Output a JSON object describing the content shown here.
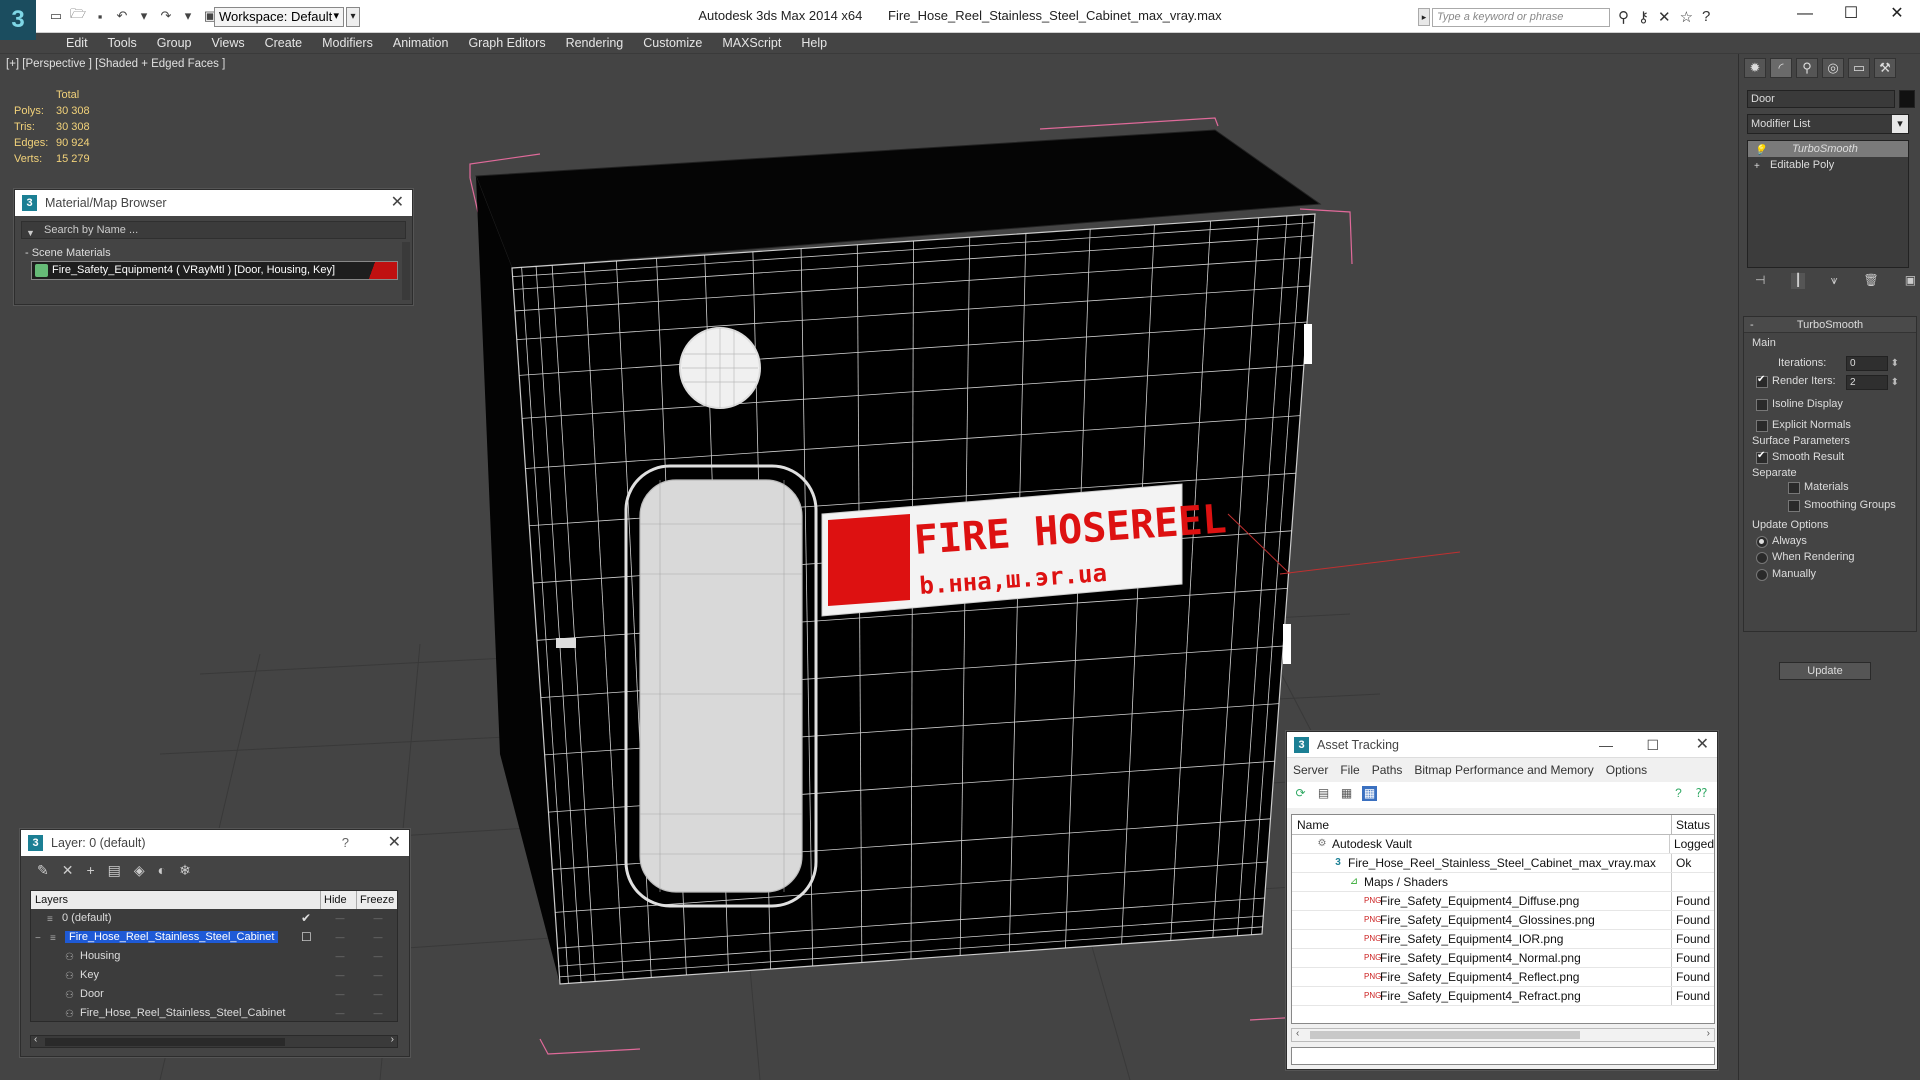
{
  "titlebar": {
    "app_name": "Autodesk 3ds Max  2014 x64",
    "file_name": "Fire_Hose_Reel_Stainless_Steel_Cabinet_max_vray.max",
    "workspace": "Workspace: Default",
    "search_placeholder": "Type a keyword or phrase"
  },
  "menu": [
    "Edit",
    "Tools",
    "Group",
    "Views",
    "Create",
    "Modifiers",
    "Animation",
    "Graph Editors",
    "Rendering",
    "Customize",
    "MAXScript",
    "Help"
  ],
  "viewport": {
    "label": "[+] [Perspective ] [Shaded + Edged Faces ]",
    "stats": {
      "header": "Total",
      "polys_label": "Polys:",
      "polys": "30 308",
      "tris_label": "Tris:",
      "tris": "30 308",
      "edges_label": "Edges:",
      "edges": "90 924",
      "verts_label": "Verts:",
      "verts": "15 279"
    },
    "sign_line1": "FIRE HOSEREEL",
    "sign_line2": "b.ннa,ш.эr.ua"
  },
  "material_browser": {
    "title": "Material/Map Browser",
    "search_placeholder": "Search by Name ...",
    "group": "- Scene Materials",
    "item": "Fire_Safety_Equipment4  ( VRayMtl )  [Door, Housing, Key]"
  },
  "layer_panel": {
    "title": "Layer: 0 (default)",
    "help": "?",
    "col_layers": "Layers",
    "col_hide": "Hide",
    "col_freeze": "Freeze",
    "rows": [
      {
        "label": "0 (default)"
      },
      {
        "label": "Fire_Hose_Reel_Stainless_Steel_Cabinet"
      },
      {
        "label": "Housing"
      },
      {
        "label": "Key"
      },
      {
        "label": "Door"
      },
      {
        "label": "Fire_Hose_Reel_Stainless_Steel_Cabinet"
      }
    ]
  },
  "asset_tracking": {
    "title": "Asset Tracking",
    "menu": [
      "Server",
      "File",
      "Paths",
      "Bitmap Performance and Memory",
      "Options"
    ],
    "col_name": "Name",
    "col_status": "Status",
    "rows": [
      {
        "name": "Autodesk Vault",
        "status": "Logged"
      },
      {
        "name": "Fire_Hose_Reel_Stainless_Steel_Cabinet_max_vray.max",
        "status": "Ok"
      },
      {
        "name": "Maps / Shaders",
        "status": ""
      },
      {
        "name": "Fire_Safety_Equipment4_Diffuse.png",
        "status": "Found"
      },
      {
        "name": "Fire_Safety_Equipment4_Glossines.png",
        "status": "Found"
      },
      {
        "name": "Fire_Safety_Equipment4_IOR.png",
        "status": "Found"
      },
      {
        "name": "Fire_Safety_Equipment4_Normal.png",
        "status": "Found"
      },
      {
        "name": "Fire_Safety_Equipment4_Reflect.png",
        "status": "Found"
      },
      {
        "name": "Fire_Safety_Equipment4_Refract.png",
        "status": "Found"
      }
    ]
  },
  "command_panel": {
    "object_name": "Door",
    "modifier_list": "Modifier List",
    "stack": [
      "TurboSmooth",
      "Editable Poly"
    ],
    "rollout_title": "TurboSmooth",
    "main_group": "Main",
    "iterations_label": "Iterations:",
    "iterations": "0",
    "render_iters_label": "Render Iters:",
    "render_iters": "2",
    "isoline": "Isoline Display",
    "explicit_normals": "Explicit Normals",
    "surface_group": "Surface Parameters",
    "smooth_result": "Smooth Result",
    "separate": "Separate",
    "materials": "Materials",
    "smoothing_groups": "Smoothing Groups",
    "update_group": "Update Options",
    "always": "Always",
    "when_rendering": "When Rendering",
    "manually": "Manually",
    "update_button": "Update"
  }
}
